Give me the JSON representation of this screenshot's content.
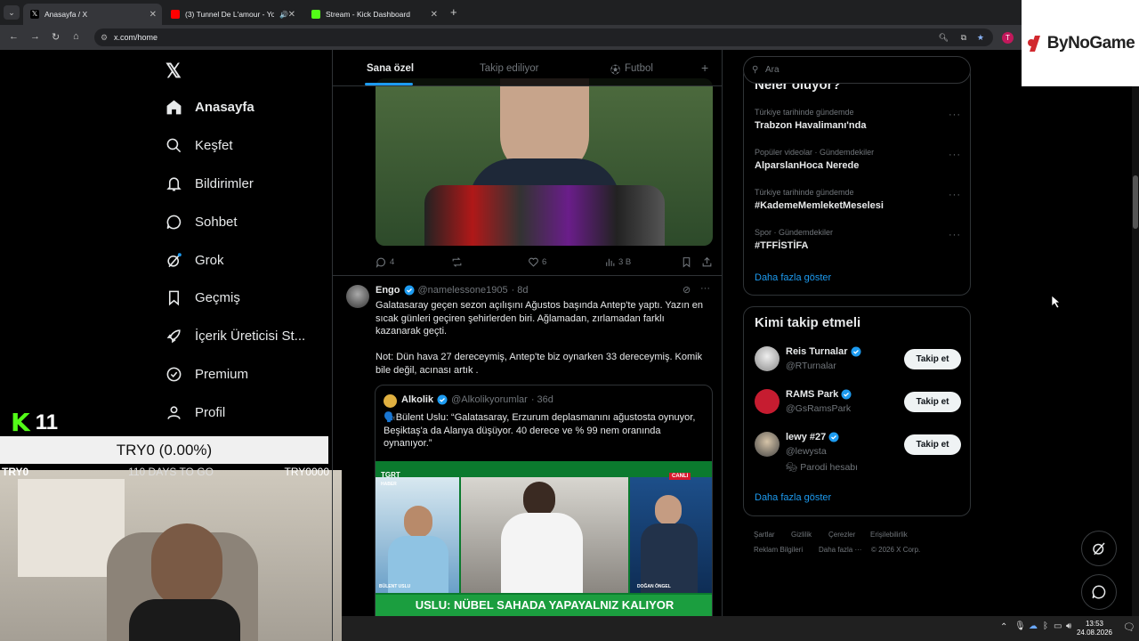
{
  "browser": {
    "tabs": [
      {
        "title": "Anasayfa / X",
        "active": true
      },
      {
        "title": "(3) Tunnel De L'amour - Yo",
        "active": false
      },
      {
        "title": "Stream - Kick Dashboard",
        "active": false
      }
    ],
    "new_tab_symbol": "+",
    "url": "x.com/home",
    "profile_initial": "T"
  },
  "brand": {
    "logo_text": "ByNoGame"
  },
  "nav": {
    "items": [
      {
        "label": "Anasayfa",
        "icon": "home-icon"
      },
      {
        "label": "Keşfet",
        "icon": "search-icon"
      },
      {
        "label": "Bildirimler",
        "icon": "bell-icon"
      },
      {
        "label": "Sohbet",
        "icon": "chat-icon"
      },
      {
        "label": "Grok",
        "icon": "grok-icon"
      },
      {
        "label": "Geçmiş",
        "icon": "bookmark-icon"
      },
      {
        "label": "İçerik Üreticisi St...",
        "icon": "rocket-icon"
      },
      {
        "label": "Premium",
        "icon": "premium-icon"
      },
      {
        "label": "Profil",
        "icon": "person-icon"
      }
    ]
  },
  "overlay": {
    "kick_logo": "K",
    "viewer_count": "11",
    "ticker": "TRY0 (0.00%)",
    "countdown": "110 DAYS TO GO",
    "left_label": "TRY0",
    "right_label": "TRY0000"
  },
  "feed": {
    "tabs": [
      "Sana özel",
      "Takip ediliyor",
      "Futbol"
    ],
    "add_symbol": "+",
    "post1_actions": {
      "replies": "4",
      "likes": "6",
      "views": "3 B"
    },
    "post2": {
      "author": "Engo",
      "handle": "@namelessone1905",
      "time": "· 8d",
      "text1": "Galatasaray geçen sezon açılışını Ağustos başında Antep'te yaptı. Yazın en sıcak günleri geçiren şehirlerden biri. Ağlamadan, zırlamadan farklı kazanarak geçti.",
      "text2": "Not: Dün hava 27 dereceymiş, Antep'te biz oynarken 33 dereceymiş. Komik bile değil, acınası artık .",
      "quote": {
        "author": "Alkolik",
        "handle": "@Alkolikyorumlar",
        "time": "· 36d",
        "text": "🗣️Bülent Uslu: “Galatasaray, Erzurum deplasmanını ağustosta oynuyor, Beşiktaş'a da Alanya düşüyor. 40 derece ve % 99 nem oranında oynanıyor.”",
        "image": {
          "channel": "TGRT",
          "channel_sub": "HABER",
          "live": "CANLI",
          "left_name": "BÜLENT USLU",
          "right_name": "DOĞAN ÖNGEL",
          "headline": "USLU: NÜBEL SAHADA YAPAYALNIZ KALIYOR"
        }
      }
    }
  },
  "sidebar": {
    "search_placeholder": "Ara",
    "trends_header": "Neler oluyor?",
    "trends": [
      {
        "category": "Türkiye tarihinde gündemde",
        "title": "Trabzon Havalimanı'nda"
      },
      {
        "category": "Popüler videolar · Gündemdekiler",
        "title": "AlparslanHoca Nerede"
      },
      {
        "category": "Türkiye tarihinde gündemde",
        "title": "#KademeMemleketMeselesi"
      },
      {
        "category": "Spor · Gündemdekiler",
        "title": "#TFFİSTİFA"
      }
    ],
    "trends_more": "Daha fazla göster",
    "follow_header": "Kimi takip etmeli",
    "follow": [
      {
        "name": "Reis Turnalar",
        "handle": "@RTurnalar",
        "button": "Takip et",
        "note": ""
      },
      {
        "name": "RAMS Park",
        "handle": "@GsRamsPark",
        "button": "Takip et",
        "note": ""
      },
      {
        "name": "lewy #27",
        "handle": "@lewysta",
        "button": "Takip et",
        "note": "Parodi hesabı"
      }
    ],
    "follow_more": "Daha fazla göster",
    "footer": [
      "Şartlar",
      "Gizlilik",
      "Çerezler",
      "Erişilebilirlik",
      "Reklam Bilgileri",
      "Daha fazla ···",
      "© 2026 X Corp."
    ]
  },
  "taskbar": {
    "time": "13:53",
    "date": "24.08.2026"
  },
  "colors": {
    "accent": "#1d9bf0",
    "kick_green": "#53fc18",
    "brand_red": "#d1282e"
  }
}
